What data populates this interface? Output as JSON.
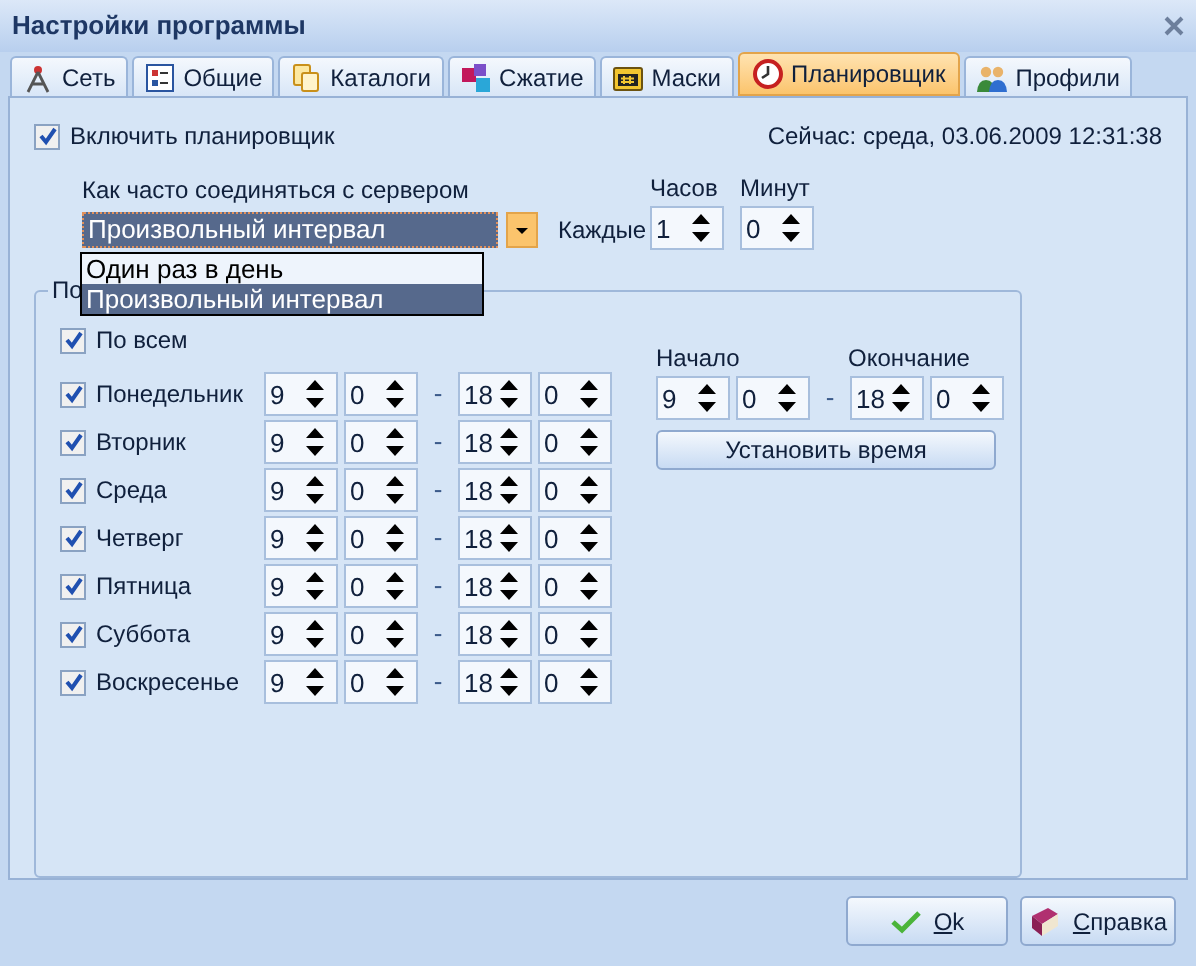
{
  "window": {
    "title": "Настройки программы"
  },
  "tabs": [
    {
      "label": "Сеть",
      "selected": false,
      "kind": "network"
    },
    {
      "label": "Общие",
      "selected": false,
      "kind": "general"
    },
    {
      "label": "Каталоги",
      "selected": false,
      "kind": "folders"
    },
    {
      "label": "Сжатие",
      "selected": false,
      "kind": "compress"
    },
    {
      "label": "Маски",
      "selected": false,
      "kind": "masks"
    },
    {
      "label": "Планировщик",
      "selected": true,
      "kind": "scheduler"
    },
    {
      "label": "Профили",
      "selected": false,
      "kind": "profiles"
    }
  ],
  "scheduler": {
    "enable": {
      "label": "Включить планировщик",
      "checked": true
    },
    "now": "Сейчас: среда, 03.06.2009 12:31:38",
    "frequency": {
      "label": "Как часто соединяться с сервером",
      "value": "Произвольный интервал",
      "expanded": true,
      "options": [
        {
          "label": "Один раз в день",
          "selected": false
        },
        {
          "label": "Произвольный интервал",
          "selected": true
        }
      ]
    },
    "interval": {
      "every_label": "Каждые",
      "hours_label": "Часов",
      "hours": "1",
      "minutes_label": "Минут",
      "minutes": "0"
    },
    "days_group": {
      "title": "По",
      "all": {
        "label": "По всем",
        "checked": true
      },
      "days": [
        {
          "label": "Понедельник",
          "checked": true,
          "start_h": "9",
          "start_m": "0",
          "separator": "-",
          "end_h": "18",
          "end_m": "0"
        },
        {
          "label": "Вторник",
          "checked": true,
          "start_h": "9",
          "start_m": "0",
          "separator": "-",
          "end_h": "18",
          "end_m": "0"
        },
        {
          "label": "Среда",
          "checked": true,
          "start_h": "9",
          "start_m": "0",
          "separator": "-",
          "end_h": "18",
          "end_m": "0"
        },
        {
          "label": "Четверг",
          "checked": true,
          "start_h": "9",
          "start_m": "0",
          "separator": "-",
          "end_h": "18",
          "end_m": "0"
        },
        {
          "label": "Пятница",
          "checked": true,
          "start_h": "9",
          "start_m": "0",
          "separator": "-",
          "end_h": "18",
          "end_m": "0"
        },
        {
          "label": "Суббота",
          "checked": true,
          "start_h": "9",
          "start_m": "0",
          "separator": "-",
          "end_h": "18",
          "end_m": "0"
        },
        {
          "label": "Воскресенье",
          "checked": true,
          "start_h": "9",
          "start_m": "0",
          "separator": "-",
          "end_h": "18",
          "end_m": "0"
        }
      ],
      "set_all": {
        "start_label": "Начало",
        "end_label": "Окончание",
        "start_h": "9",
        "start_m": "0",
        "separator": "-",
        "end_h": "18",
        "end_m": "0",
        "button": "Установить время"
      }
    }
  },
  "buttons": [
    {
      "label": "Ok",
      "kind": "ok"
    },
    {
      "label": "Справка",
      "kind": "help"
    }
  ]
}
